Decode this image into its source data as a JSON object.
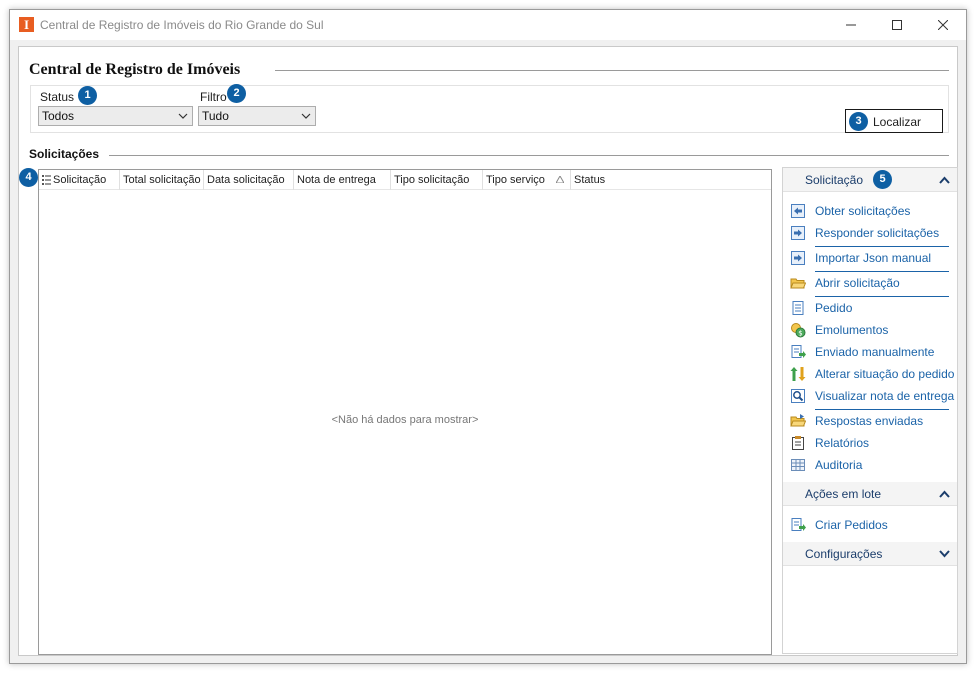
{
  "window": {
    "title": "Central de Registro de Imóveis do Rio Grande do Sul",
    "app_icon_letter": "I",
    "controls": [
      "minimize",
      "maximize",
      "close"
    ]
  },
  "main": {
    "section_title": "Central de Registro de Imóveis",
    "status": {
      "label": "Status",
      "value": "Todos",
      "badge": "1"
    },
    "filtro": {
      "label": "Filtro",
      "value": "Tudo",
      "badge": "2"
    },
    "localizar": {
      "label": "Localizar",
      "badge": "3"
    }
  },
  "solicitacoes": {
    "title": "Solicitações",
    "badge": "4",
    "columns": [
      "Solicitação",
      "Total solicitação",
      "Data solicitação",
      "Nota de entrega",
      "Tipo solicitação",
      "Tipo serviço",
      "Status"
    ],
    "empty_text": "<Não há dados para mostrar>"
  },
  "sidebar": {
    "solicitacao": {
      "title": "Solicitação",
      "badge": "5",
      "items": [
        {
          "label": "Obter solicitações",
          "icon": "arrow-left-icon"
        },
        {
          "label": "Responder solicitações",
          "icon": "arrow-right-icon"
        },
        {
          "label": "Importar Json manual",
          "icon": "import-icon"
        },
        {
          "label": "Abrir solicitação",
          "icon": "folder-open-icon"
        },
        {
          "label": "Pedido",
          "icon": "document-icon"
        },
        {
          "label": "Emolumentos",
          "icon": "coins-icon"
        },
        {
          "label": "Enviado manualmente",
          "icon": "send-manual-icon"
        },
        {
          "label": "Alterar situação do pedido",
          "icon": "swap-arrows-icon"
        },
        {
          "label": "Visualizar nota de entrega",
          "icon": "magnifier-icon"
        },
        {
          "label": "Respostas enviadas",
          "icon": "folder-send-icon"
        },
        {
          "label": "Relatórios",
          "icon": "report-icon"
        },
        {
          "label": "Auditoria",
          "icon": "audit-grid-icon"
        }
      ]
    },
    "acoes_em_lote": {
      "title": "Ações em lote",
      "items": [
        {
          "label": "Criar Pedidos",
          "icon": "create-orders-icon"
        }
      ]
    },
    "configuracoes": {
      "title": "Configurações"
    }
  },
  "colors": {
    "accent": "#0e5fa3",
    "link": "#1b63a8",
    "app_icon": "#e85d21"
  }
}
